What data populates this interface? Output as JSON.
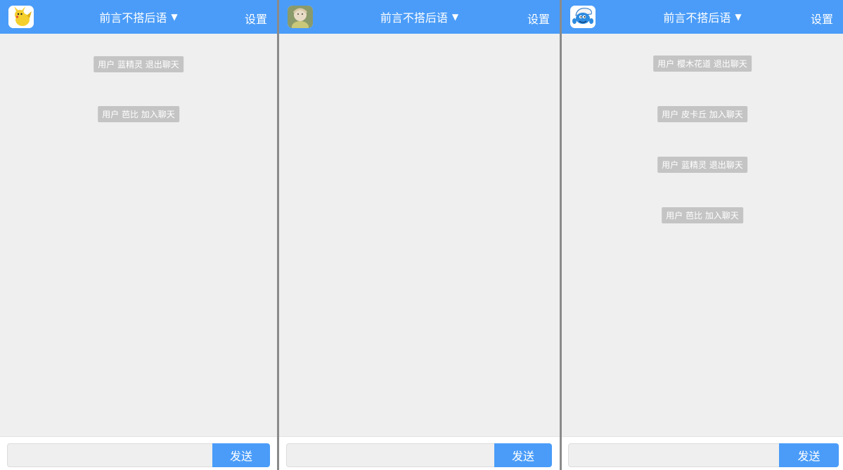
{
  "panels": [
    {
      "avatar": "pikachu-avatar",
      "room_title": "前言不搭后语",
      "caret": "▼",
      "settings_label": "设置",
      "notices": [
        "用户 蓝精灵 退出聊天",
        "用户 芭比 加入聊天"
      ],
      "input_value": "",
      "send_label": "发送"
    },
    {
      "avatar": "girl-photo-avatar",
      "room_title": "前言不搭后语",
      "caret": "▼",
      "settings_label": "设置",
      "notices": [],
      "input_value": "",
      "send_label": "发送"
    },
    {
      "avatar": "smurf-avatar",
      "room_title": "前言不搭后语",
      "caret": "▼",
      "settings_label": "设置",
      "notices": [
        "用户 樱木花道 退出聊天",
        "用户 皮卡丘 加入聊天",
        "用户 蓝精灵 退出聊天",
        "用户 芭比 加入聊天"
      ],
      "input_value": "",
      "send_label": "发送"
    }
  ],
  "colors": {
    "accent": "#4a9cf8",
    "background": "#efefef",
    "notice_bg": "#c4c4c4"
  }
}
